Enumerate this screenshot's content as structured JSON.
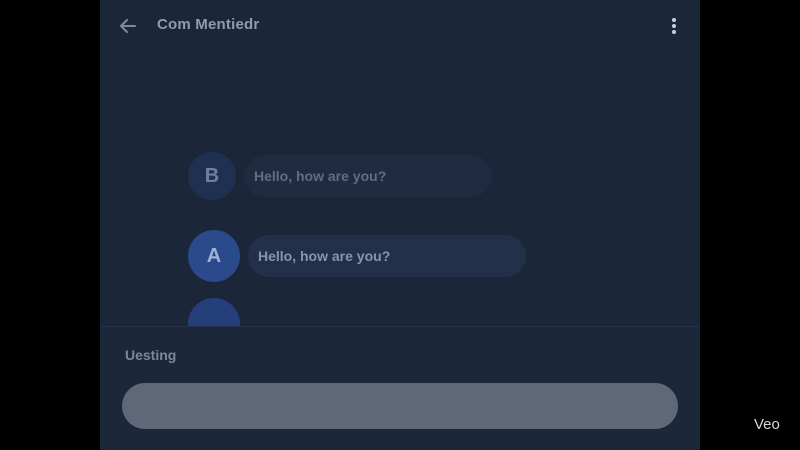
{
  "header": {
    "title": "Com Mentiedr",
    "back_icon": "arrow-left-icon",
    "more_icon": "more-vertical-icon"
  },
  "messages": [
    {
      "avatar_letter": "B",
      "text": "Hello, how are   you?"
    },
    {
      "avatar_letter": "A",
      "text": "Hello, how are you?"
    }
  ],
  "composer": {
    "label": "Uesting",
    "value": "",
    "placeholder": ""
  },
  "watermark": "Veo",
  "colors": {
    "background": "#1b2638",
    "avatar_a": "#2a4a8c",
    "input_fill": "#5e6878"
  }
}
